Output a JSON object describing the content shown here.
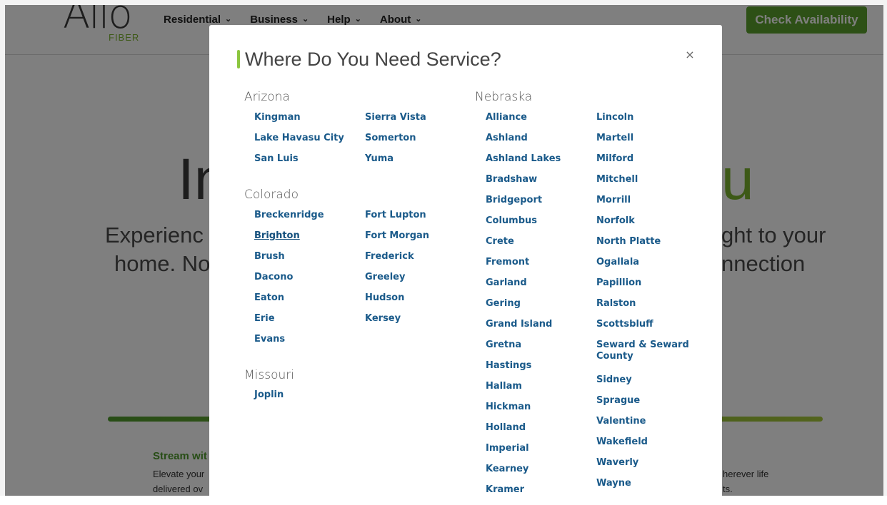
{
  "header": {
    "logo_text": "Allo",
    "logo_sub": "FIBER",
    "nav": [
      "Residential",
      "Business",
      "Help",
      "About"
    ],
    "cta": "Check Availability"
  },
  "hero": {
    "title_left": "In",
    "title_right": "u",
    "sub_l1": "Experienc",
    "sub_l2": "home. No",
    "sub_r1": "ght to your",
    "sub_r2": "nnection"
  },
  "feature": {
    "title": "Stream wit",
    "text_l1": "Elevate your",
    "text_l2": "delivered ov",
    "text_r1": "herever life",
    "text_r2": "ts."
  },
  "modal": {
    "title": "Where Do You Need Service?",
    "close": "×",
    "states": {
      "arizona": {
        "name": "Arizona",
        "col1": [
          "Kingman",
          "Lake Havasu City",
          "San Luis"
        ],
        "col2": [
          "Sierra Vista",
          "Somerton",
          "Yuma"
        ]
      },
      "colorado": {
        "name": "Colorado",
        "col1": [
          "Breckenridge",
          "Brighton",
          "Brush",
          "Dacono",
          "Eaton",
          "Erie",
          "Evans"
        ],
        "col2": [
          "Fort Lupton",
          "Fort Morgan",
          "Frederick",
          "Greeley",
          "Hudson",
          "Kersey"
        ]
      },
      "missouri": {
        "name": "Missouri",
        "col1": [
          "Joplin"
        ]
      },
      "nebraska": {
        "name": "Nebraska",
        "col1": [
          "Alliance",
          "Ashland",
          "Ashland Lakes",
          "Bradshaw",
          "Bridgeport",
          "Columbus",
          "Crete",
          "Fremont",
          "Garland",
          "Gering",
          "Grand Island",
          "Gretna",
          "Hastings",
          "Hallam",
          "Hickman",
          "Holland",
          "Imperial",
          "Kearney",
          "Kramer"
        ],
        "col2": [
          "Lincoln",
          "Martell",
          "Milford",
          "Mitchell",
          "Morrill",
          "Norfolk",
          "North Platte",
          "Ogallala",
          "Papillion",
          "Ralston",
          "Scottsbluff",
          "Seward & Seward County",
          "Sidney",
          "Sprague",
          "Valentine",
          "Wakefield",
          "Waverly",
          "Wayne"
        ]
      }
    }
  },
  "colors": {
    "accent_green": "#8cc63f",
    "cta_green": "#5aa02c",
    "link_blue": "#1a5a8a"
  }
}
